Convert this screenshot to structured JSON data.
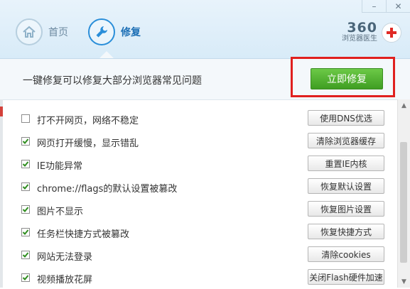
{
  "header": {
    "tabs": [
      {
        "label": "首页",
        "icon": "home-icon",
        "active": false
      },
      {
        "label": "修复",
        "icon": "wrench-icon",
        "active": true
      }
    ],
    "brand": {
      "number": "360",
      "name": "浏览器医生",
      "icon": "red-cross-icon"
    },
    "window_buttons": [
      {
        "icon": "minimize-icon",
        "glyph": "–"
      },
      {
        "icon": "close-icon",
        "glyph": "✕"
      }
    ]
  },
  "topbar": {
    "message": "一键修复可以修复大部分浏览器常见问题",
    "fix_now_label": "立即修复",
    "accent": "#4aab2b",
    "highlight": "#e0201e"
  },
  "issues": [
    {
      "label": "打不开网页，网络不稳定",
      "checked": false,
      "action": "使用DNS优选"
    },
    {
      "label": "网页打开缓慢，显示错乱",
      "checked": true,
      "action": "清除浏览器缓存"
    },
    {
      "label": "IE功能异常",
      "checked": true,
      "action": "重置IE内核"
    },
    {
      "label": "chrome://flags的默认设置被篡改",
      "checked": true,
      "action": "恢复默认设置"
    },
    {
      "label": "图片不显示",
      "checked": true,
      "action": "恢复图片设置"
    },
    {
      "label": "任务栏快捷方式被篡改",
      "checked": true,
      "action": "恢复快捷方式"
    },
    {
      "label": "网站无法登录",
      "checked": true,
      "action": "清除cookies"
    },
    {
      "label": "视频播放花屏",
      "checked": true,
      "action": "关闭Flash硬件加速"
    }
  ]
}
